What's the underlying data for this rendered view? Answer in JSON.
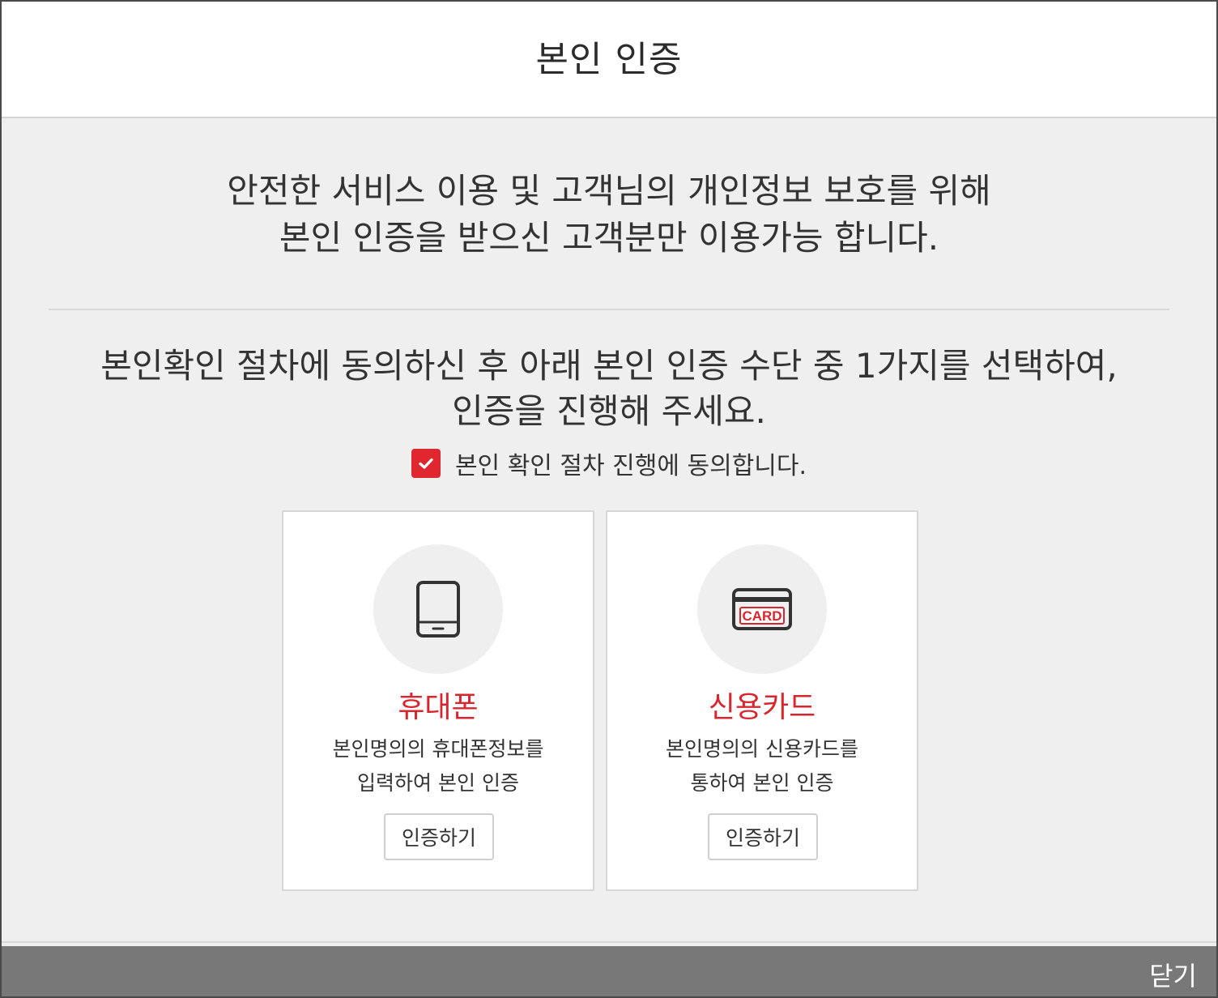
{
  "header": {
    "title": "본인 인증"
  },
  "intro": {
    "line1": "안전한 서비스 이용 및 고객님의 개인정보 보호를 위해",
    "line2": "본인 인증을 받으신 고객분만 이용가능 합니다."
  },
  "instruction": {
    "line1": "본인확인 절차에 동의하신 후 아래 본인 인증 수단 중 1가지를 선택하여,",
    "line2": "인증을 진행해 주세요."
  },
  "agreement": {
    "checked": true,
    "label": "본인 확인 절차 진행에 동의합니다.",
    "check_color": "#e0262f"
  },
  "methods": [
    {
      "icon": "mobile-phone-icon",
      "title": "휴대폰",
      "desc_line1": "본인명의의 휴대폰정보를",
      "desc_line2": "입력하여 본인 인증",
      "button_label": "인증하기"
    },
    {
      "icon": "credit-card-icon",
      "icon_text": "CARD",
      "title": "신용카드",
      "desc_line1": "본인명의의 신용카드를",
      "desc_line2": "통하여 본인 인증",
      "button_label": "인증하기"
    }
  ],
  "footer": {
    "close_label": "닫기"
  },
  "colors": {
    "accent_red": "#d8262f",
    "footer_bg": "#787878",
    "page_bg": "#efefef"
  }
}
